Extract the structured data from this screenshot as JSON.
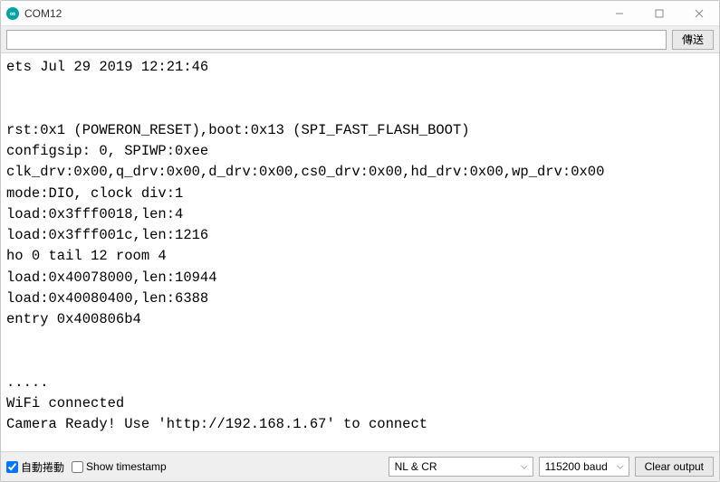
{
  "window": {
    "title": "COM12"
  },
  "toolbar": {
    "input_value": "",
    "send_label": "傳送"
  },
  "console_output": "ets Jul 29 2019 12:21:46\n\n\nrst:0x1 (POWERON_RESET),boot:0x13 (SPI_FAST_FLASH_BOOT)\nconfigsip: 0, SPIWP:0xee\nclk_drv:0x00,q_drv:0x00,d_drv:0x00,cs0_drv:0x00,hd_drv:0x00,wp_drv:0x00\nmode:DIO, clock div:1\nload:0x3fff0018,len:4\nload:0x3fff001c,len:1216\nho 0 tail 12 room 4\nload:0x40078000,len:10944\nload:0x40080400,len:6388\nentry 0x400806b4\n\n\n.....\nWiFi connected\nCamera Ready! Use 'http://192.168.1.67' to connect\n",
  "bottombar": {
    "autoscroll_label": "自動捲動",
    "autoscroll_checked": true,
    "timestamp_label": "Show timestamp",
    "timestamp_checked": false,
    "line_ending": "NL & CR",
    "baud": "115200 baud",
    "clear_label": "Clear output"
  }
}
